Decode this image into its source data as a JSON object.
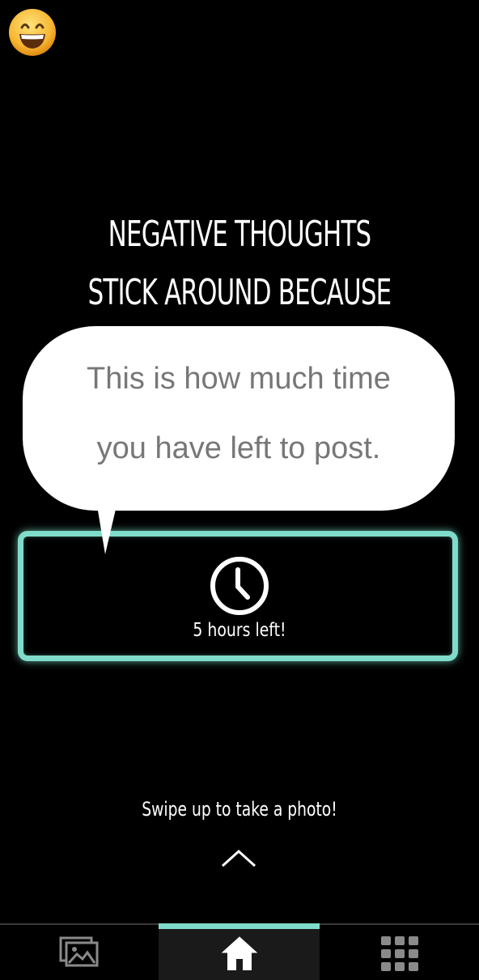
{
  "avatar": {
    "icon": "grinning-face-emoji-icon"
  },
  "prompt": {
    "line1": "NEGATIVE THOUGHTS",
    "line2": "STICK AROUND BECAUSE"
  },
  "tooltip": {
    "line1": "This is how much time",
    "line2": "you have left to post."
  },
  "timer": {
    "icon": "clock-icon",
    "label": "5 hours left!",
    "accent_color": "#7fdcca"
  },
  "swipe": {
    "label": "Swipe up to take a photo!",
    "icon": "chevron-up-icon"
  },
  "bottom_nav": {
    "items": [
      {
        "id": "gallery",
        "icon": "gallery-icon",
        "active": false
      },
      {
        "id": "home",
        "icon": "home-icon",
        "active": true
      },
      {
        "id": "grid",
        "icon": "grid-icon",
        "active": false
      }
    ]
  }
}
